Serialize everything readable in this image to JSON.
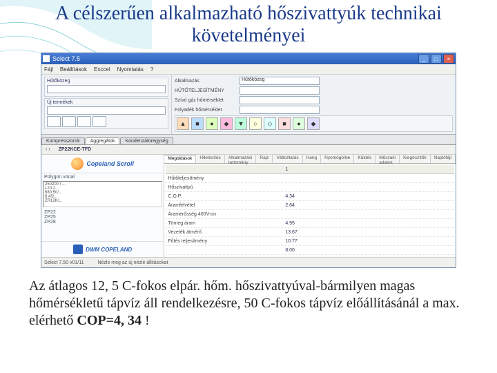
{
  "slide": {
    "title": "A célszerűen alkalmazható hőszivattyúk technikai követelményei",
    "caption_1": "Az átlagos 12, 5 C-fokos elpár. hőm. hőszivattyúval-bármilyen magas hőmérsékletű tápvíz áll rendelkezésre, 50 C-fokos tápvíz előállításánál a max. elérhető ",
    "caption_bold": "COP=4, 34",
    "caption_2": " !"
  },
  "app": {
    "title": "Select 7.5",
    "win_min": "_",
    "win_max": "□",
    "win_close": "×",
    "menu": [
      "Fájl",
      "Beállítások",
      "Exccel",
      "Nyomtatás",
      "?"
    ],
    "group_title": "Hűtőközeg",
    "group2_title": "Új termékek",
    "right_params": [
      {
        "label": "Alkalmazás",
        "value": "Hűtőközeg"
      },
      {
        "label": "HŰTŐTELJESÍTMÉNY",
        "value": ""
      },
      {
        "label": "Szívó gáz hőmérséklet",
        "value": ""
      },
      {
        "label": "Folyadék hőmérséklet",
        "value": ""
      }
    ],
    "icons": [
      "▲",
      "■",
      "●",
      "◆",
      "▼",
      "○",
      "◇",
      "■",
      "●",
      "◆"
    ],
    "tabs": [
      "Kompresszorok",
      "Aggregátok",
      "Kondenzátoregység"
    ],
    "midbar_left": "‹  ›",
    "midbar_model": "ZP22KCE-TFD",
    "subtabs": [
      "Megoldások",
      "Hitelesítés",
      "Alkalmazási tartomány",
      "Rajz",
      "Változtatás",
      "Hang",
      "Nyomógörbe",
      "Küldés",
      "Műszaki adatok",
      "Kiegészítők",
      "Naplófájl"
    ],
    "left_list_title": "Polygon vonal",
    "left_list": [
      " 250200 / ...",
      " L2/L2... ",
      " 680.50/...",
      " 6.45/...",
      " ZR12K/..."
    ],
    "left_items": [
      "ZP22",
      "ZP25",
      "ZP28"
    ],
    "brand1": "Copeland Scroll",
    "brand2": "DWM COPELAND",
    "data_rows": [
      {
        "k": "Hűtőteljesítmény",
        "v": ""
      },
      {
        "k": "Hőszivattyú",
        "v": ""
      },
      {
        "k": "C.O.P.",
        "v": "4.34"
      },
      {
        "k": "Áramfelvétel",
        "v": "2.64"
      },
      {
        "k": "Áramerősség 400V-on",
        "v": ""
      },
      {
        "k": "Tömeg áram",
        "v": "4.95"
      },
      {
        "k": "Vezeték átmérő",
        "v": "13.67"
      },
      {
        "k": "Fűtés teljesítmény",
        "v": "10.77"
      },
      {
        "k": "",
        "v": "8.00"
      }
    ],
    "data_header": "1",
    "status_left": "Select 7.50   v01/11",
    "status_right": "Nézle meg az új nézle állitásokat"
  }
}
